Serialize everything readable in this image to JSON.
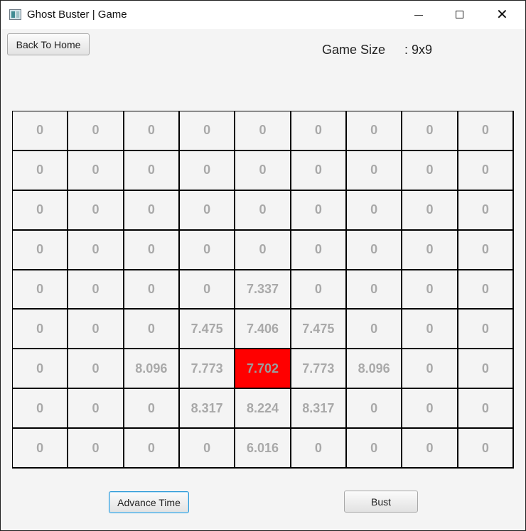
{
  "window": {
    "title": "Ghost Buster | Game",
    "controls": {
      "minimize": "minimize-icon",
      "maximize": "maximize-icon",
      "close": "✕"
    }
  },
  "toolbar": {
    "back_label": "Back To Home",
    "game_size_label": "Game Size",
    "game_size_value": ": 9x9"
  },
  "grid": {
    "rows": 9,
    "cols": 9,
    "selected_cell": {
      "row": 7,
      "col": 5
    },
    "values": [
      [
        "0",
        "0",
        "0",
        "0",
        "0",
        "0",
        "0",
        "0",
        "0"
      ],
      [
        "0",
        "0",
        "0",
        "0",
        "0",
        "0",
        "0",
        "0",
        "0"
      ],
      [
        "0",
        "0",
        "0",
        "0",
        "0",
        "0",
        "0",
        "0",
        "0"
      ],
      [
        "0",
        "0",
        "0",
        "0",
        "0",
        "0",
        "0",
        "0",
        "0"
      ],
      [
        "0",
        "0",
        "0",
        "0",
        "7.337",
        "0",
        "0",
        "0",
        "0"
      ],
      [
        "0",
        "0",
        "0",
        "7.475",
        "7.406",
        "7.475",
        "0",
        "0",
        "0"
      ],
      [
        "0",
        "0",
        "8.096",
        "7.773",
        "7.702",
        "7.773",
        "8.096",
        "0",
        "0"
      ],
      [
        "0",
        "0",
        "0",
        "8.317",
        "8.224",
        "8.317",
        "0",
        "0",
        "0"
      ],
      [
        "0",
        "0",
        "0",
        "0",
        "6.016",
        "0",
        "0",
        "0",
        "0"
      ]
    ]
  },
  "actions": {
    "advance_label": "Advance Time",
    "bust_label": "Bust"
  },
  "colors": {
    "selected_cell": "#ff0000",
    "focus_border": "#2c9ad8"
  }
}
